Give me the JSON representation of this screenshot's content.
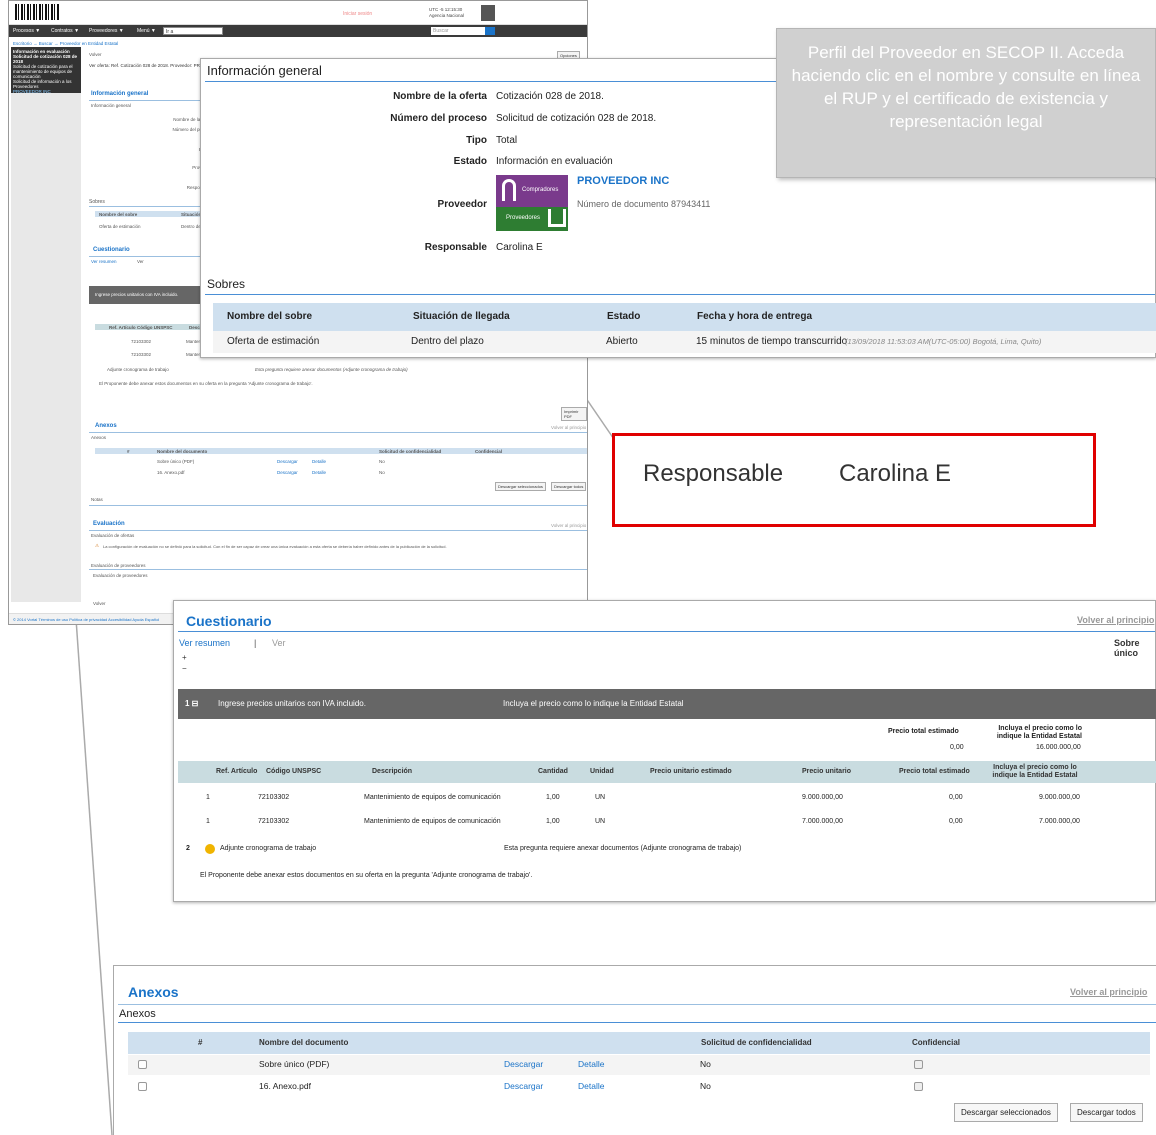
{
  "background_page": {
    "login_link": "Iniciar sesión",
    "user_time": "UTC -5 12:15:30",
    "user_org": "Agencia Nacional",
    "nav_items": [
      "Procesos ▼",
      "Contratos ▼",
      "Proveedores ▼",
      "Menú ▼"
    ],
    "nav_select": "Ir a",
    "nav_search": "Buscar",
    "breadcrumb": "Escritorio → Buscar → Proveedor en Entidad Estatal",
    "back_label": "Volver",
    "options_label": "Opciones",
    "left_box_lines": [
      "Información en evaluación",
      "Solicitud de cotización 028 de 2018",
      "Solicitud de cotización para el mantenimiento de equipos de comunicación",
      "Solicitud de información a los Proveedores",
      "PROVEEDOR INC"
    ],
    "offer_bar": "Ver oferta:   Ref. Cotización 028 de 2018. Proveedor: PR",
    "sections": {
      "info_general": "Información general",
      "info_sub": "Información general",
      "sobres": "Sobres",
      "cuestionario": "Cuestionario",
      "anexos": "Anexos",
      "anexos_sub": "Anexos",
      "notas": "Notas",
      "evaluacion": "Evaluación",
      "eval_ofertas": "Evaluación de ofertas",
      "eval_proveedores": "Evaluación de proveedores",
      "eval_proveedores_sub": "Evaluación de proveedores"
    },
    "eval_warning": "La configuración de evaluación no se definió para la solicitud. Con el fin de ser capaz de crear una única evaluación a esta oferta se debería haber definido antes de la publicación de la solicitud.",
    "info_labels": [
      "Nombre de la oferta",
      "Número del proceso",
      "Tipo",
      "Estado",
      "Proveedor",
      "Responsable"
    ],
    "sobres_cols": [
      "Nombre del sobre",
      "Situación de llegada"
    ],
    "sobres_row": [
      "Oferta de estimación",
      "Dentro del plazo"
    ],
    "cuest_links": [
      "Ver resumen",
      "Ver"
    ],
    "cuest_row": "Ingrese precios unitarios con IVA incluido.",
    "cuest_cols": [
      "Ref. Artículo",
      "Código UNSPSC",
      "Descripción"
    ],
    "cuest_codes": [
      "72103302",
      "72103302"
    ],
    "cuest_desc": "Mantenimiento de",
    "cuest_q2": "Adjunte cronograma de trabajo",
    "cuest_q2_note": "Esta pregunta requiere anexar documentos (Adjunte cronograma de trabajo)",
    "cuest_note": "El Proponente debe anexar estos documentos en su oferta en la pregunta 'Adjunte cronograma de trabajo'.",
    "pdf_button": "Imprimir PDF",
    "back_to_top": "Volver al principio",
    "anexos_cols": [
      "#",
      "Nombre del documento",
      "Solicitud de confidencialidad",
      "Confidencial"
    ],
    "anexos_rows": [
      {
        "name": "Sobre único (PDF)",
        "download": "Descargar",
        "detail": "Detalle",
        "conf": "No"
      },
      {
        "name": "16. Anexo.pdf",
        "download": "Descargar",
        "detail": "Detalle",
        "conf": "No"
      }
    ],
    "btn_sel": "Descargar seleccionados",
    "btn_all": "Descargar todos",
    "volver_btn": "Volver",
    "footer": "© 2014 Vortal  Términos de uso  Política de privacidad  Accesibilidad  Ayuda  Español"
  },
  "info_panel": {
    "title": "Información general",
    "fields": [
      {
        "label": "Nombre de la oferta",
        "value": "Cotización 028 de 2018."
      },
      {
        "label": "Número del proceso",
        "value": "Solicitud de cotización 028 de 2018."
      },
      {
        "label": "Tipo",
        "value": "Total"
      },
      {
        "label": "Estado",
        "value": "Información en evaluación"
      }
    ],
    "provider_label": "Proveedor",
    "provider_name": "PROVEEDOR INC",
    "provider_doc": "Número de documento 87943411",
    "logo_top": "Compradores",
    "logo_bottom": "Proveedores",
    "responsible_label": "Responsable",
    "responsible_value": "Carolina E",
    "sobres_title": "Sobres",
    "sobres_headers": [
      "Nombre del sobre",
      "Situación de llegada",
      "Estado",
      "Fecha y hora de entrega"
    ],
    "sobres_row": {
      "name": "Oferta de estimación",
      "arrival": "Dentro del plazo",
      "state": "Abierto",
      "delivery": "15 minutos de tiempo transcurrido",
      "delivery_detail": "(13/09/2018 11:53:03 AM(UTC-05:00) Bogotá, Lima, Quito)"
    }
  },
  "callout": {
    "text": "Perfil del Proveedor en SECOP II. Acceda haciendo clic en el nombre y consulte en línea el RUP y el certificado de existencia y representación legal"
  },
  "zoom_box": {
    "label": "Responsable",
    "value": "Carolina E"
  },
  "cuestionario": {
    "title": "Cuestionario",
    "back_to_top": "Volver al principio",
    "link_summary": "Ver resumen",
    "separator": "|",
    "link_view": "Ver",
    "sobre_unico": "Sobre único",
    "expand": "+",
    "collapse": "−",
    "row_number": "1 ⊟",
    "row_text": "Ingrese precios unitarios con IVA incluido.",
    "row_text2": "Incluya el precio como lo indique la Entidad Estatal",
    "summary_h1": "Precio total estimado",
    "summary_h2": "Incluya el precio como lo indique la Entidad Estatal",
    "summary_v1": "0,00",
    "summary_v2": "16.000.000,00",
    "columns": [
      "Ref. Artículo",
      "Código UNSPSC",
      "Descripción",
      "Cantidad",
      "Unidad",
      "Precio unitario estimado",
      "Precio unitario",
      "Precio total estimado",
      "Incluya el precio como lo indique la Entidad Estatal"
    ],
    "rows": [
      {
        "ref": "1",
        "code": "72103302",
        "desc": "Mantenimiento de equipos de comunicación",
        "qty": "1,00",
        "unit": "UN",
        "price": "9.000.000,00",
        "total_est": "0,00",
        "entity": "9.000.000,00"
      },
      {
        "ref": "1",
        "code": "72103302",
        "desc": "Mantenimiento de equipos de comunicación",
        "qty": "1,00",
        "unit": "UN",
        "price": "7.000.000,00",
        "total_est": "0,00",
        "entity": "7.000.000,00"
      }
    ],
    "q2_number": "2",
    "q2_text": "Adjunte cronograma de trabajo",
    "q2_note": "Esta pregunta requiere anexar documentos (Adjunte cronograma de trabajo)",
    "note": "El Proponente debe anexar estos documentos en su oferta en la pregunta 'Adjunte cronograma de trabajo'."
  },
  "anexos": {
    "title": "Anexos",
    "back_to_top": "Volver al principio",
    "subtitle": "Anexos",
    "columns": [
      "#",
      "Nombre del documento",
      "Solicitud de confidencialidad",
      "Confidencial"
    ],
    "rows": [
      {
        "name": "Sobre único (PDF)",
        "download": "Descargar",
        "detail": "Detalle",
        "conf_request": "No"
      },
      {
        "name": "16. Anexo.pdf",
        "download": "Descargar",
        "detail": "Detalle",
        "conf_request": "No"
      }
    ],
    "btn_download_selected": "Descargar seleccionados",
    "btn_download_all": "Descargar todos"
  },
  "colors": {
    "accent": "#1a73c8",
    "highlight_border": "#e00000",
    "callout_bg": "#d0d0d0",
    "logo_purple": "#7a3a8c",
    "logo_green": "#2e7d32"
  }
}
